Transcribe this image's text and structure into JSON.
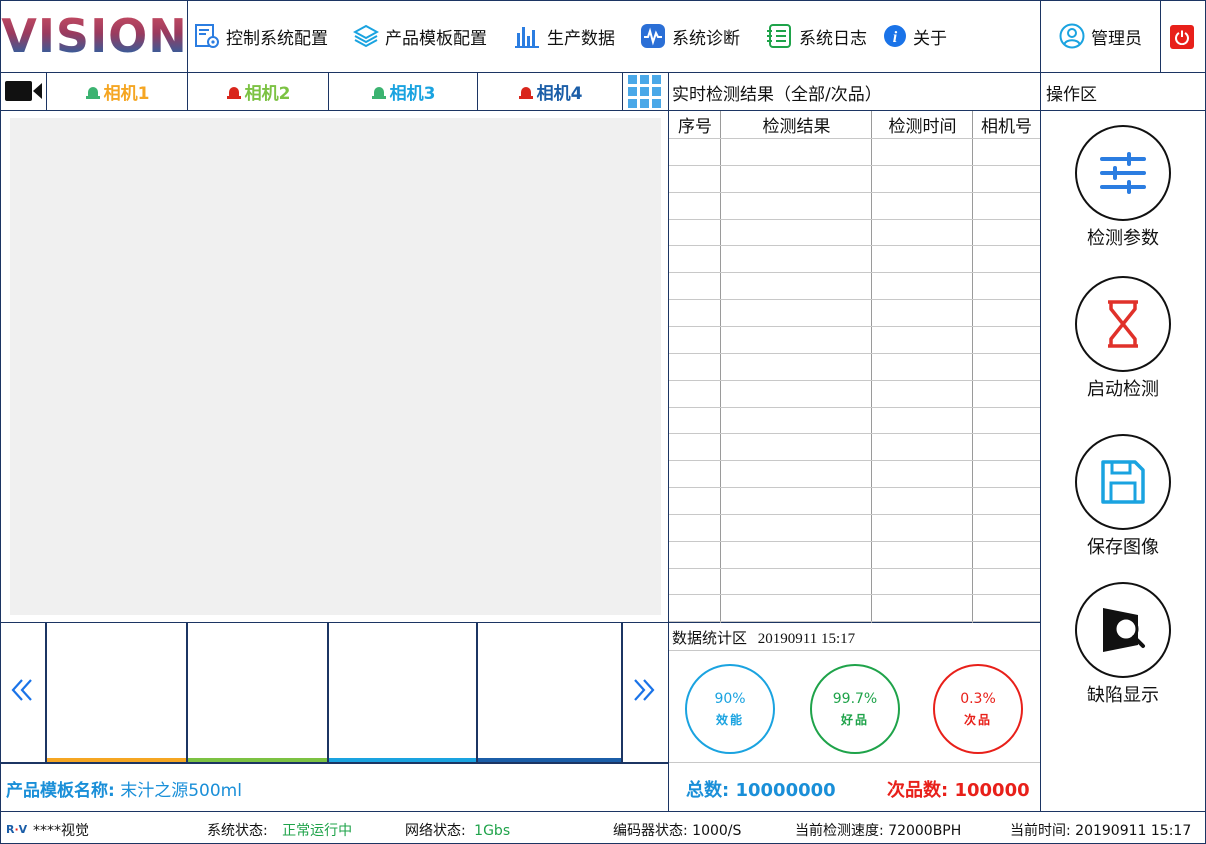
{
  "app": {
    "logo_text": "VISION"
  },
  "nav": [
    {
      "label": "控制系统配置",
      "icon": "control-config-icon"
    },
    {
      "label": "产品模板配置",
      "icon": "layers-icon"
    },
    {
      "label": "生产数据",
      "icon": "bar-chart-icon"
    },
    {
      "label": "系统诊断",
      "icon": "diagnosis-icon"
    },
    {
      "label": "系统日志",
      "icon": "log-list-icon"
    },
    {
      "label": "关于",
      "icon": "info-icon"
    }
  ],
  "user": {
    "label": "管理员"
  },
  "cameras": [
    {
      "label": "相机1",
      "color": "#f5a623",
      "alarm_color": "#3cb371"
    },
    {
      "label": "相机2",
      "color": "#7cc243",
      "alarm_color": "#d9261c"
    },
    {
      "label": "相机3",
      "color": "#1aa3e0",
      "alarm_color": "#3cb371"
    },
    {
      "label": "相机4",
      "color": "#1b5ea8",
      "alarm_color": "#d9261c"
    }
  ],
  "results": {
    "title": "实时检测结果（全部/次品）",
    "columns": [
      "序号",
      "检测结果",
      "检测时间",
      "相机号"
    ],
    "rows": []
  },
  "operations": {
    "title": "操作区",
    "buttons": [
      {
        "label": "检测参数",
        "icon": "sliders-icon"
      },
      {
        "label": "启动检测",
        "icon": "hourglass-icon"
      },
      {
        "label": "保存图像",
        "icon": "save-icon"
      },
      {
        "label": "缺陷显示",
        "icon": "defect-search-icon"
      }
    ]
  },
  "stats": {
    "title": "数据统计区",
    "timestamp": "20190911 15:17",
    "efficiency": {
      "value": "90%",
      "label": "效能",
      "color": "#1aa3e0"
    },
    "good": {
      "value": "99.7%",
      "label": "好品",
      "color": "#1fa34a"
    },
    "defect": {
      "value": "0.3%",
      "label": "次品",
      "color": "#e8201a"
    },
    "total_label": "总数:",
    "total_value": "10000000",
    "defect_count_label": "次品数:",
    "defect_count_value": "100000"
  },
  "product": {
    "label": "产品模板名称:",
    "value": "末汁之源500ml"
  },
  "status_bar": {
    "brand": "****视觉",
    "system_label": "系统状态:",
    "system_value": "正常运行中",
    "network_label": "网络状态:",
    "network_value": "1Gbs",
    "encoder": "编码器状态: 1000/S",
    "speed": "当前检测速度: 72000BPH",
    "time": "当前时间: 20190911 15:17"
  },
  "thumb_colors": [
    "#f5a623",
    "#7cc243",
    "#1aa3e0",
    "#1b5ea8"
  ]
}
